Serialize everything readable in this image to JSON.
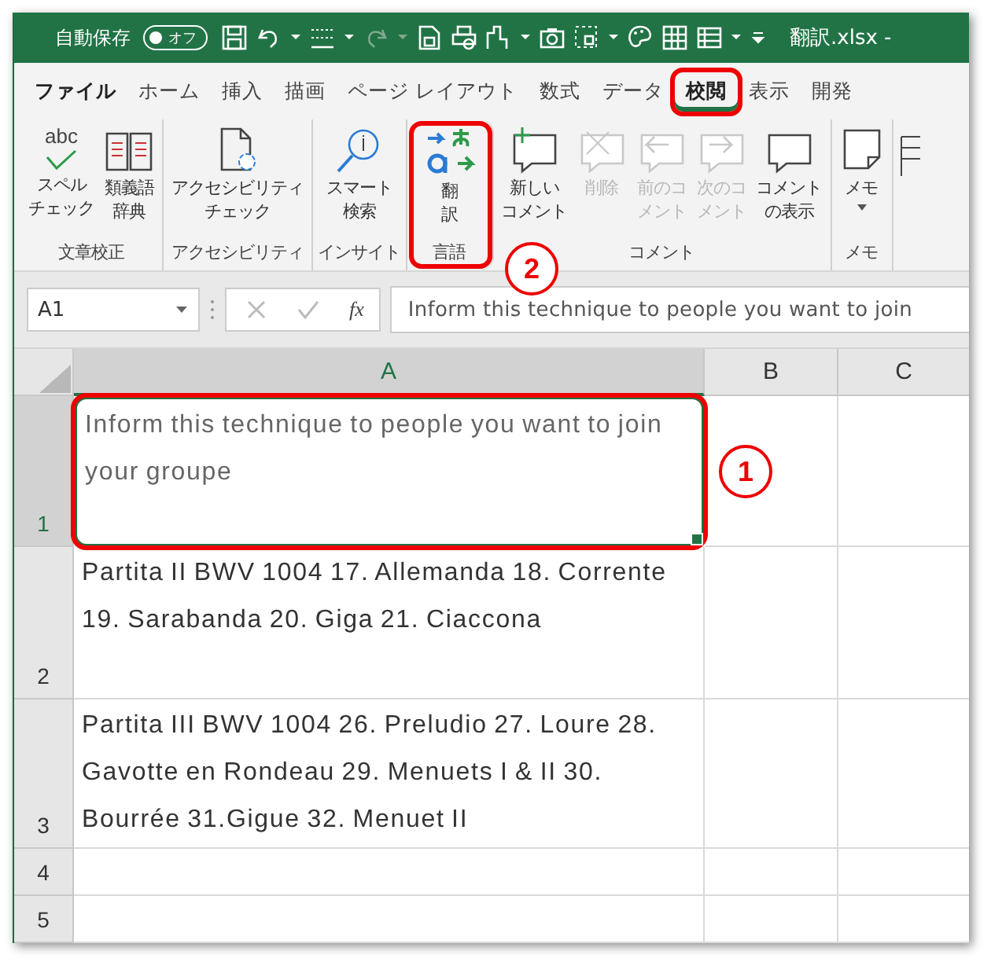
{
  "title_bar": {
    "autosave_label": "自動保存",
    "autosave_toggle": {
      "label": "オフ",
      "on": false
    },
    "file_name": "翻訳.xlsx -"
  },
  "tabs": [
    {
      "label": "ファイル",
      "selected": false,
      "highlighted": false,
      "kind": "file"
    },
    {
      "label": "ホーム",
      "selected": false,
      "highlighted": false,
      "kind": "tab"
    },
    {
      "label": "挿入",
      "selected": false,
      "highlighted": false,
      "kind": "tab"
    },
    {
      "label": "描画",
      "selected": false,
      "highlighted": false,
      "kind": "tab"
    },
    {
      "label": "ページ レイアウト",
      "selected": false,
      "highlighted": false,
      "kind": "tab"
    },
    {
      "label": "数式",
      "selected": false,
      "highlighted": false,
      "kind": "tab"
    },
    {
      "label": "データ",
      "selected": false,
      "highlighted": false,
      "kind": "tab"
    },
    {
      "label": "校閲",
      "selected": true,
      "highlighted": true,
      "kind": "tab"
    },
    {
      "label": "表示",
      "selected": false,
      "highlighted": false,
      "kind": "tab"
    },
    {
      "label": "開発",
      "selected": false,
      "highlighted": false,
      "kind": "tab"
    }
  ],
  "ribbon_groups": [
    {
      "label": "文章校正",
      "highlighted": false,
      "commands": [
        {
          "lines": [
            "スペル",
            "チェック"
          ],
          "icon_text": "abc",
          "kind": "spell",
          "disabled": false
        },
        {
          "lines": [
            "類義語",
            "辞典"
          ],
          "kind": "book",
          "disabled": false
        }
      ]
    },
    {
      "label": "アクセシビリティ",
      "highlighted": false,
      "commands": [
        {
          "lines": [
            "アクセシビリティ",
            "チェック"
          ],
          "kind": "access",
          "disabled": false
        }
      ]
    },
    {
      "label": "インサイト",
      "highlighted": false,
      "commands": [
        {
          "lines": [
            "スマート",
            "検索"
          ],
          "kind": "lookup",
          "disabled": false
        }
      ]
    },
    {
      "label": "言語",
      "highlighted": true,
      "commands": [
        {
          "lines": [
            "翻",
            "訳"
          ],
          "kind": "translate",
          "disabled": false
        }
      ]
    },
    {
      "label": "コメント",
      "highlighted": false,
      "commands": [
        {
          "lines": [
            "新しい",
            "コメント"
          ],
          "kind": "newcomment",
          "disabled": false
        },
        {
          "lines": [
            "削除"
          ],
          "kind": "delcomment",
          "disabled": true
        },
        {
          "lines": [
            "前のコ",
            "メント"
          ],
          "kind": "prevcomment",
          "disabled": true
        },
        {
          "lines": [
            "次のコ",
            "メント"
          ],
          "kind": "nextcomment",
          "disabled": true
        },
        {
          "lines": [
            "コメント",
            "の表示"
          ],
          "kind": "comment",
          "disabled": false
        }
      ]
    },
    {
      "label": "メモ",
      "highlighted": false,
      "commands": [
        {
          "lines": [
            "メモ"
          ],
          "kind": "note",
          "disabled": false,
          "dropdown": true
        }
      ]
    }
  ],
  "formula_bar": {
    "name_box": "A1",
    "function_label": "fx",
    "formula": "Inform this technique to people you want to join"
  },
  "sheet": {
    "columns": [
      {
        "label": "A",
        "selected": true
      },
      {
        "label": "B",
        "selected": false
      },
      {
        "label": "C",
        "selected": false
      }
    ],
    "rows": [
      {
        "label": "1",
        "selected": true,
        "highlighted": true,
        "a": "Inform this technique to people you want to join your groupe"
      },
      {
        "label": "2",
        "selected": false,
        "highlighted": false,
        "a": "Partita II BWV 1004 17. Allemanda 18. Corrente 19. Sarabanda 20. Giga 21. Ciaccona"
      },
      {
        "label": "3",
        "selected": false,
        "highlighted": false,
        "a": "Partita III BWV 1004 26. Preludio 27. Loure 28. Gavotte en Rondeau 29. Menuets I & II 30. Bourrée 31.Gigue 32. Menuet II"
      },
      {
        "label": "4",
        "selected": false,
        "highlighted": false
      },
      {
        "label": "5",
        "selected": false,
        "highlighted": false
      }
    ]
  },
  "callouts": [
    {
      "label": "1"
    },
    {
      "label": "2"
    }
  ]
}
